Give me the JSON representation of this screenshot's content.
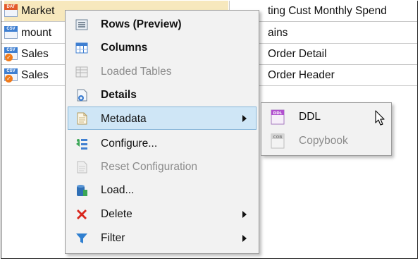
{
  "table": {
    "rows": [
      {
        "name": "Market",
        "icon_tag": "DAT",
        "tag_color": "#e35a2a",
        "desc": "ting Cust Monthly Spend",
        "selected": true
      },
      {
        "name": "mount",
        "icon_tag": "CSV",
        "tag_color": "#3f7fd1",
        "desc": "ains",
        "selected": false
      },
      {
        "name": "Sales",
        "icon_tag": "CSV",
        "tag_color": "#3f7fd1",
        "desc": "Order Detail",
        "selected": false
      },
      {
        "name": "Sales",
        "icon_tag": "CSV",
        "tag_color": "#3f7fd1",
        "desc": "Order Header",
        "selected": false
      }
    ]
  },
  "context_menu": {
    "items": [
      {
        "label": "Rows (Preview)",
        "icon": "rows-preview-icon",
        "bold": true,
        "disabled": false
      },
      {
        "label": "Columns",
        "icon": "columns-icon",
        "bold": true,
        "disabled": false
      },
      {
        "label": "Loaded Tables",
        "icon": "loaded-tables-icon",
        "bold": false,
        "disabled": true
      },
      {
        "label": "Details",
        "icon": "details-icon",
        "bold": true,
        "disabled": false
      },
      {
        "label": "Metadata",
        "icon": "metadata-icon",
        "bold": false,
        "disabled": false,
        "submenu": true,
        "highlighted": true
      },
      {
        "label": "Configure...",
        "icon": "configure-icon",
        "bold": false,
        "disabled": false
      },
      {
        "label": "Reset Configuration",
        "icon": "reset-configuration-icon",
        "bold": false,
        "disabled": true
      },
      {
        "label": "Load...",
        "icon": "load-icon",
        "bold": false,
        "disabled": false
      },
      {
        "label": "Delete",
        "icon": "delete-icon",
        "bold": false,
        "disabled": false,
        "submenu": true
      },
      {
        "label": "Filter",
        "icon": "filter-icon",
        "bold": false,
        "disabled": false,
        "submenu": true
      }
    ]
  },
  "metadata_submenu": {
    "items": [
      {
        "label": "DDL",
        "icon_tag": "DDL",
        "disabled": false
      },
      {
        "label": "Copybook",
        "icon_tag": "COB",
        "disabled": true
      }
    ]
  },
  "colors": {
    "menu_highlight": "#cfe6f6",
    "selected_row": "#f7e8bd",
    "disabled_text": "#8c8c8c"
  }
}
